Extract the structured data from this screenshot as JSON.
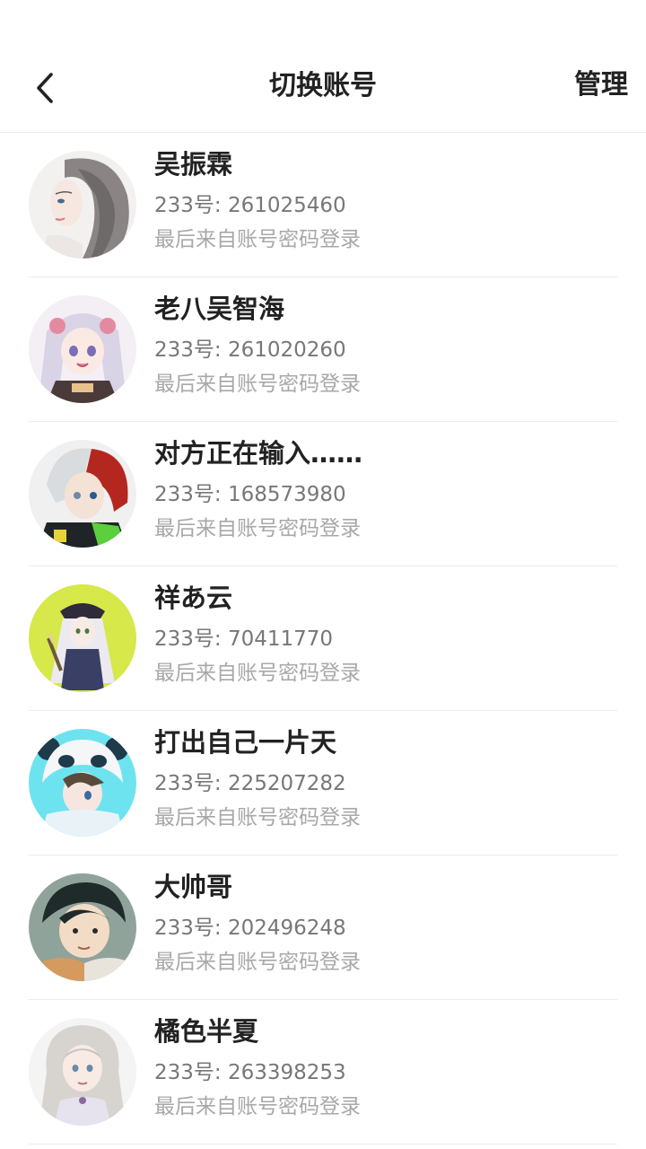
{
  "header": {
    "title": "切换账号",
    "manage_label": "管理",
    "back_icon": "chevron-left-icon"
  },
  "accounts": [
    {
      "name": "吴振霖",
      "id_text": "233号: 261025460",
      "login_text": "最后来自账号密码登录"
    },
    {
      "name": "老八吴智海",
      "id_text": "233号: 261020260",
      "login_text": "最后来自账号密码登录"
    },
    {
      "name": "对方正在输入……",
      "id_text": "233号: 168573980",
      "login_text": "最后来自账号密码登录"
    },
    {
      "name": "祥あ云",
      "id_text": "233号: 70411770",
      "login_text": "最后来自账号密码登录"
    },
    {
      "name": "打出自己一片天",
      "id_text": "233号: 225207282",
      "login_text": "最后来自账号密码登录"
    },
    {
      "name": "大帅哥",
      "id_text": "233号: 202496248",
      "login_text": "最后来自账号密码登录"
    },
    {
      "name": "橘色半夏",
      "id_text": "233号: 263398253",
      "login_text": "最后来自账号密码登录"
    }
  ]
}
